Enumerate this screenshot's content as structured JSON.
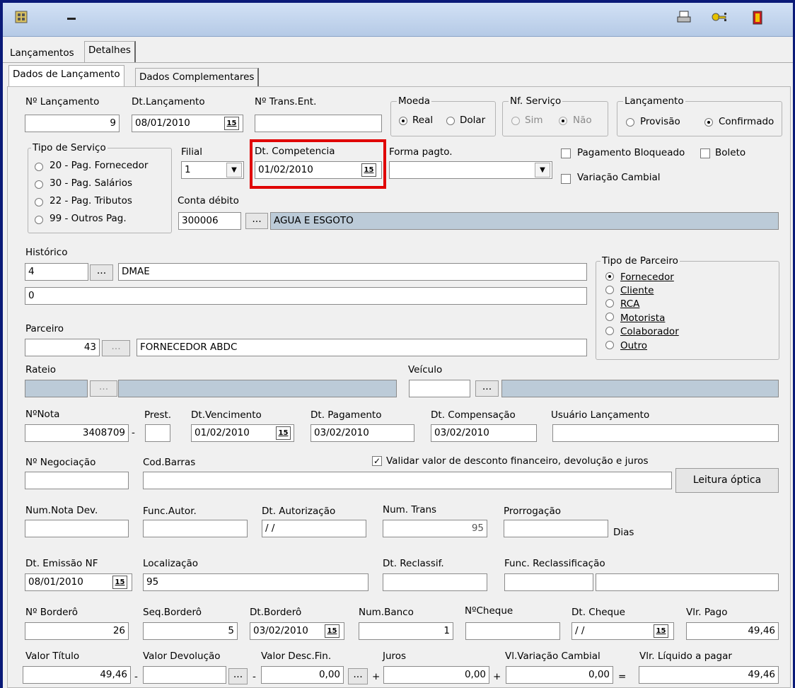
{
  "toolbar": {
    "icons": [
      "calc-icon",
      "minimize-icon",
      "print-icon",
      "key-icon",
      "exit-icon"
    ]
  },
  "tabs": {
    "main": [
      "Lançamentos",
      "Detalhes"
    ],
    "sub": [
      "Dados de Lançamento",
      "Dados Complementares"
    ]
  },
  "form": {
    "n_lancamento": {
      "label": "Nº Lançamento",
      "value": "9"
    },
    "dt_lancamento": {
      "label": "Dt.Lançamento",
      "value": "08/01/2010"
    },
    "n_trans_ent": {
      "label": "Nº Trans.Ent.",
      "value": ""
    },
    "moeda": {
      "label": "Moeda",
      "options": [
        "Real",
        "Dolar"
      ]
    },
    "nf_servico": {
      "label": "Nf. Serviço",
      "options": [
        "Sim",
        "Não"
      ]
    },
    "lancamento": {
      "label": "Lançamento",
      "options": [
        "Provisão",
        "Confirmado"
      ]
    },
    "tipo_servico": {
      "label": "Tipo de Serviço",
      "options": [
        "20 - Pag. Fornecedor",
        "30 - Pag. Salários",
        "22 - Pag. Tributos",
        "99 - Outros Pag."
      ]
    },
    "filial": {
      "label": "Filial",
      "value": "1"
    },
    "dt_competencia": {
      "label": "Dt. Competencia",
      "value": "01/02/2010"
    },
    "forma_pagto": {
      "label": "Forma pagto.",
      "value": ""
    },
    "pagamento_bloqueado": "Pagamento Bloqueado",
    "boleto": "Boleto",
    "variacao_cambial": "Variação Cambial",
    "conta_debito": {
      "label": "Conta débito",
      "code": "300006",
      "desc": "AGUA E ESGOTO"
    },
    "historico": {
      "label": "Histórico",
      "code": "4",
      "desc": "DMAE",
      "line2": "0"
    },
    "tipo_parceiro": {
      "label": "Tipo de Parceiro",
      "options": [
        "Fornecedor",
        "Cliente",
        "RCA",
        "Motorista",
        "Colaborador",
        "Outro"
      ]
    },
    "parceiro": {
      "label": "Parceiro",
      "code": "43",
      "desc": "FORNECEDOR ABDC"
    },
    "rateio": {
      "label": "Rateio"
    },
    "veiculo": {
      "label": "Veículo"
    },
    "n_nota": {
      "label": "NºNota",
      "value": "3408709"
    },
    "prest": {
      "label": "Prest.",
      "value": ""
    },
    "dt_vencimento": {
      "label": "Dt.Vencimento",
      "value": "01/02/2010"
    },
    "dt_pagamento": {
      "label": "Dt. Pagamento",
      "value": "03/02/2010"
    },
    "dt_compensacao": {
      "label": "Dt. Compensação",
      "value": "03/02/2010"
    },
    "usuario_lancamento": {
      "label": "Usuário Lançamento",
      "value": ""
    },
    "n_negociacao": {
      "label": "Nº Negociação"
    },
    "cod_barras": {
      "label": "Cod.Barras"
    },
    "validar": "Validar valor de desconto financeiro,  devolução e juros",
    "leitura_optica": "Leitura óptica",
    "num_nota_dev": {
      "label": "Num.Nota Dev."
    },
    "func_autor": {
      "label": "Func.Autor."
    },
    "dt_autorizacao": {
      "label": "Dt. Autorização",
      "value": " / /"
    },
    "num_trans": {
      "label": "Num. Trans",
      "value": "95"
    },
    "prorrogacao": {
      "label": "Prorrogação",
      "unit": "Dias"
    },
    "dt_emissao_nf": {
      "label": "Dt. Emissão NF",
      "value": "08/01/2010"
    },
    "localizacao": {
      "label": "Localização",
      "value": "95"
    },
    "dt_reclassif": {
      "label": "Dt. Reclassif."
    },
    "func_reclassificacao": {
      "label": "Func. Reclassificação"
    },
    "n_bordero": {
      "label": "Nº Borderô",
      "value": "26"
    },
    "seq_bordero": {
      "label": "Seq.Borderô",
      "value": "5"
    },
    "dt_bordero": {
      "label": "Dt.Borderô",
      "value": "03/02/2010"
    },
    "num_banco": {
      "label": "Num.Banco",
      "value": "1"
    },
    "n_cheque": {
      "label": "NºCheque",
      "value": ""
    },
    "dt_cheque": {
      "label": "Dt. Cheque",
      "value": " / /"
    },
    "vlr_pago": {
      "label": "Vlr. Pago",
      "value": "49,46"
    },
    "valor_titulo": {
      "label": "Valor Título",
      "value": "49,46"
    },
    "valor_devolucao": {
      "label": "Valor Devolução",
      "value": ""
    },
    "valor_desc_fin": {
      "label": "Valor Desc.Fin.",
      "value": "0,00"
    },
    "juros": {
      "label": "Juros",
      "value": "0,00"
    },
    "vl_variacao_cambial": {
      "label": "Vl.Variação Cambial",
      "value": "0,00"
    },
    "vlr_liquido": {
      "label": "Vlr. Líquido a pagar",
      "value": "49,46"
    }
  },
  "symbols": {
    "cal": "15",
    "dots": "...",
    "dd": "▼",
    "minus": "-",
    "plus": "+",
    "eq": "="
  },
  "colors": {
    "highlight": "#e00000",
    "readonly_field": "#bccbd8",
    "frame": "#0a1a78"
  }
}
